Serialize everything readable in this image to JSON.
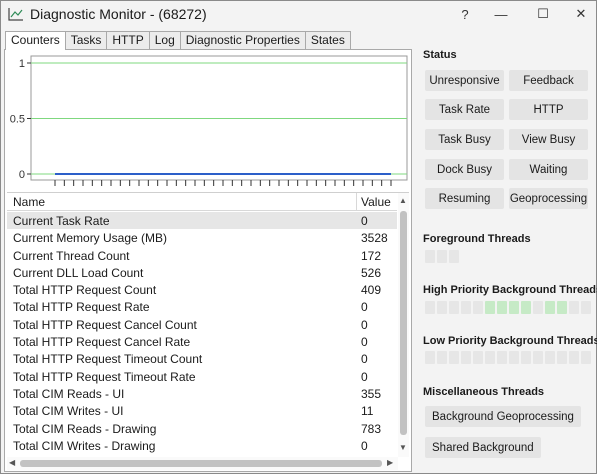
{
  "window": {
    "title": "Diagnostic Monitor - (68272)",
    "help_label": "?",
    "minimize_label": "—",
    "maximize_label": "☐",
    "close_label": "✕"
  },
  "tabs": [
    {
      "label": "Counters",
      "active": true
    },
    {
      "label": "Tasks"
    },
    {
      "label": "HTTP"
    },
    {
      "label": "Log"
    },
    {
      "label": "Diagnostic Properties"
    },
    {
      "label": "States"
    }
  ],
  "chart_data": {
    "type": "line",
    "y_ticks": [
      "1",
      "0.5",
      "0"
    ],
    "ylim": [
      0,
      1
    ],
    "series": [
      {
        "values": [
          0,
          0,
          0,
          0,
          0,
          0,
          0,
          0,
          0,
          0,
          0,
          0,
          0,
          0,
          0,
          0,
          0,
          0,
          0,
          0,
          0,
          0,
          0,
          0,
          0,
          0,
          0,
          0,
          0,
          0,
          0,
          0,
          0,
          0,
          0,
          0,
          0
        ],
        "color": "#2c5fc9"
      }
    ],
    "gridline_color": "#7fd87f",
    "grid": true
  },
  "counters": {
    "col_name": "Name",
    "col_value": "Value",
    "rows": [
      {
        "name": "Current Task Rate",
        "value": "0"
      },
      {
        "name": "Current Memory Usage (MB)",
        "value": "3528"
      },
      {
        "name": "Current Thread Count",
        "value": "172"
      },
      {
        "name": "Current DLL Load Count",
        "value": "526"
      },
      {
        "name": "Total HTTP Request Count",
        "value": "409"
      },
      {
        "name": "Total HTTP Request Rate",
        "value": "0"
      },
      {
        "name": "Total HTTP Request Cancel Count",
        "value": "0"
      },
      {
        "name": "Total HTTP Request Cancel Rate",
        "value": "0"
      },
      {
        "name": "Total HTTP Request Timeout Count",
        "value": "0"
      },
      {
        "name": "Total HTTP Request Timeout Rate",
        "value": "0"
      },
      {
        "name": "Total CIM Reads - UI",
        "value": "355"
      },
      {
        "name": "Total CIM Writes - UI",
        "value": "11"
      },
      {
        "name": "Total CIM Reads - Drawing",
        "value": "783"
      },
      {
        "name": "Total CIM Writes - Drawing",
        "value": "0"
      }
    ]
  },
  "status": {
    "title": "Status",
    "buttons": [
      "Unresponsive",
      "Feedback",
      "Task Rate",
      "HTTP",
      "Task Busy",
      "View Busy",
      "Dock Busy",
      "Waiting",
      "Resuming",
      "Geoprocessing"
    ]
  },
  "threads": {
    "foreground_title": "Foreground Threads",
    "foreground_cells": [
      0,
      0,
      0
    ],
    "high_title": "High Priority Background Threads",
    "high_cells": [
      0,
      0,
      0,
      0,
      0,
      1,
      1,
      1,
      1,
      0,
      1,
      1,
      0,
      0
    ],
    "low_title": "Low Priority Background Threads",
    "low_cells": [
      0,
      0,
      0,
      0,
      0,
      0,
      0,
      0,
      0,
      0,
      0,
      0,
      0,
      0
    ],
    "misc_title": "Miscellaneous Threads",
    "misc_buttons": [
      "Background Geoprocessing",
      "Shared Background"
    ]
  }
}
